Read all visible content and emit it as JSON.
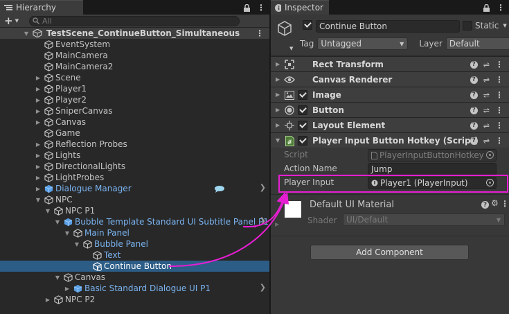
{
  "hierarchy": {
    "tab_title": "Hierarchy",
    "search_placeholder": "All",
    "scene_name": "TestScene_ContinueButton_Simultaneous",
    "items": [
      {
        "label": "EventSystem"
      },
      {
        "label": "MainCamera"
      },
      {
        "label": "MainCamera2"
      },
      {
        "label": "Scene"
      },
      {
        "label": "Player1"
      },
      {
        "label": "Player2"
      },
      {
        "label": "SniperCanvas"
      },
      {
        "label": "Canvas"
      },
      {
        "label": "Game"
      },
      {
        "label": "Reflection Probes"
      },
      {
        "label": "Lights"
      },
      {
        "label": "DirectionalLights"
      },
      {
        "label": "LightProbes"
      },
      {
        "label": "Dialogue Manager"
      },
      {
        "label": "NPC"
      },
      {
        "label": "NPC P1"
      },
      {
        "label": "Bubble Template Standard UI Subtitle Panel P1"
      },
      {
        "label": "Main Panel"
      },
      {
        "label": "Bubble Panel"
      },
      {
        "label": "Text"
      },
      {
        "label": "Continue Button"
      },
      {
        "label": "Canvas"
      },
      {
        "label": "Basic Standard Dialogue UI P1"
      },
      {
        "label": "NPC P2"
      }
    ]
  },
  "inspector": {
    "tab_title": "Inspector",
    "object_name": "Continue Button",
    "static_label": "Static",
    "tag_label": "Tag",
    "tag_value": "Untagged",
    "layer_label": "Layer",
    "layer_value": "Default",
    "components": [
      {
        "name": "Rect Transform"
      },
      {
        "name": "Canvas Renderer"
      },
      {
        "name": "Image"
      },
      {
        "name": "Button"
      },
      {
        "name": "Layout Element"
      },
      {
        "name": "Player Input Button Hotkey (Script)"
      }
    ],
    "script_label": "Script",
    "script_value": "PlayerInputButtonHotkey",
    "action_name_label": "Action Name",
    "action_name_value": "Jump",
    "player_input_label": "Player Input",
    "player_input_value": "Player1 (PlayerInput)",
    "material_name": "Default UI Material",
    "shader_label": "Shader",
    "shader_value": "UI/Default",
    "add_component_label": "Add Component"
  },
  "colors": {
    "selection": "#2c5d87",
    "prefab_blue": "#7ab3f0",
    "annotation_magenta": "#e61ed2"
  }
}
